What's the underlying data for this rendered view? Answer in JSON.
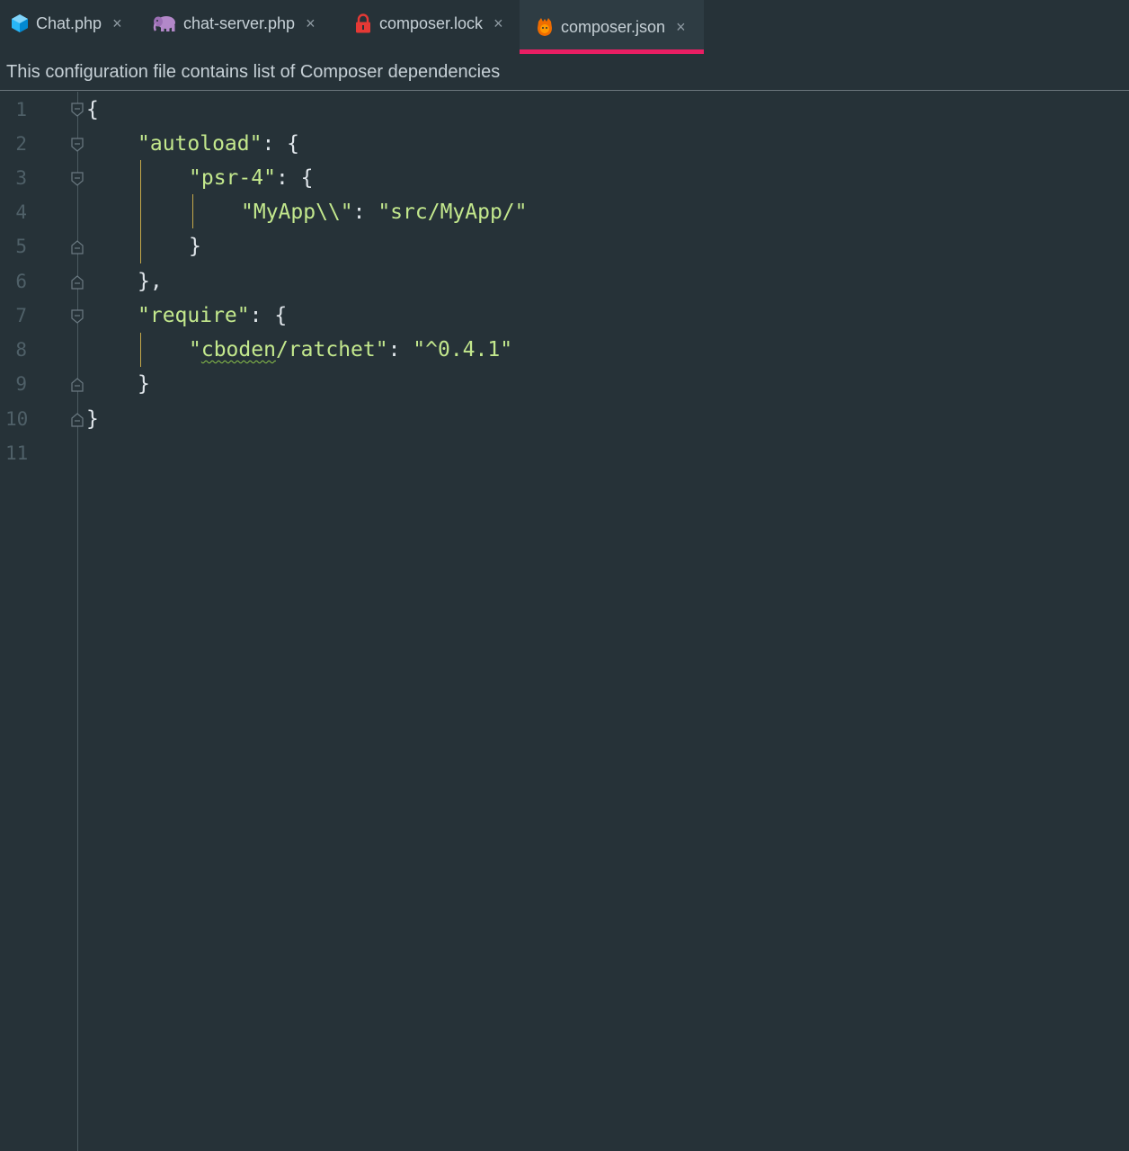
{
  "tabs": [
    {
      "label": "Chat.php",
      "icon": "php-class-icon",
      "active": false
    },
    {
      "label": "chat-server.php",
      "icon": "php-elephant-icon",
      "active": false
    },
    {
      "label": "composer.lock",
      "icon": "lock-icon",
      "active": false
    },
    {
      "label": "composer.json",
      "icon": "composer-icon",
      "active": true
    }
  ],
  "close_glyph": "×",
  "banner": {
    "text": "This configuration file contains list of Composer dependencies"
  },
  "editor": {
    "line_numbers": [
      "1",
      "2",
      "3",
      "4",
      "5",
      "6",
      "7",
      "8",
      "9",
      "10",
      "11"
    ],
    "lines": {
      "l1_brace": "{",
      "l2_key": "\"autoload\"",
      "l2_punct": ": {",
      "l3_key": "\"psr-4\"",
      "l3_punct": ": {",
      "l4_key": "\"MyApp\\\\\"",
      "l4_punct": ": ",
      "l4_value": "\"src/MyApp/\"",
      "l5_brace": "}",
      "l6_brace": "},",
      "l7_key": "\"require\"",
      "l7_punct": ": {",
      "l8_quote_open": "\"",
      "l8_key_vendor": "cboden",
      "l8_key_rest": "/ratchet\"",
      "l8_punct": ": ",
      "l8_value": "\"^0.4.1\"",
      "l9_brace": "}",
      "l10_brace": "}"
    }
  },
  "colors": {
    "background": "#263238",
    "string": "#c3e88d",
    "accent_underline": "#e91e63",
    "line_number": "#4f6068"
  }
}
